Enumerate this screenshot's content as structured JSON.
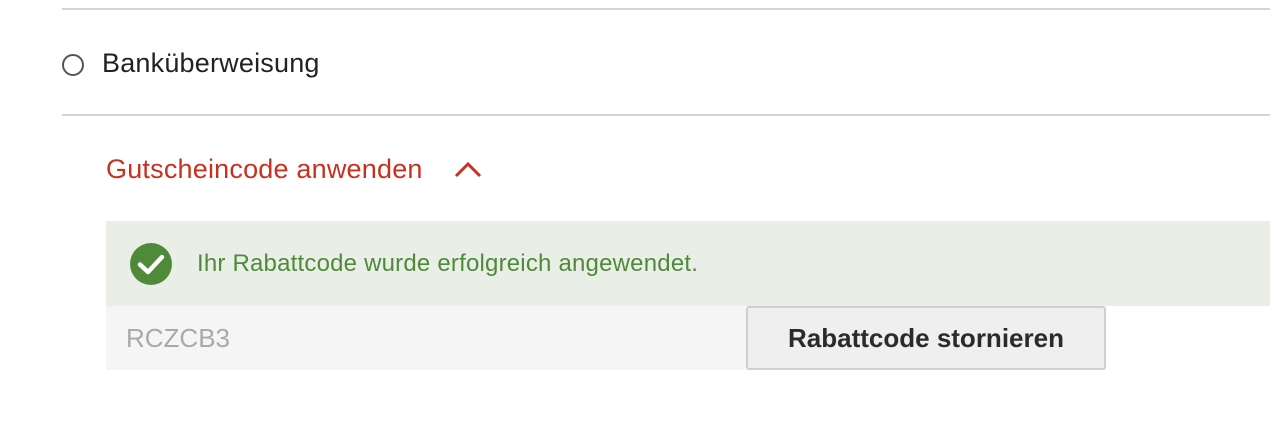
{
  "payment": {
    "option_label": "Banküberweisung",
    "selected": false
  },
  "coupon": {
    "toggle_label": "Gutscheincode anwenden",
    "expanded": true,
    "success_message": "Ihr Rabattcode wurde erfolgreich angewendet.",
    "code_value": "RCZCB3",
    "cancel_label": "Rabattcode stornieren"
  },
  "colors": {
    "accent_red": "#c8311f",
    "success_green": "#4f8a3a",
    "success_bg": "#e9efe7"
  },
  "icons": {
    "radio": "radio-unchecked-icon",
    "toggle": "chevron-up-icon",
    "success": "check-circle-icon"
  }
}
